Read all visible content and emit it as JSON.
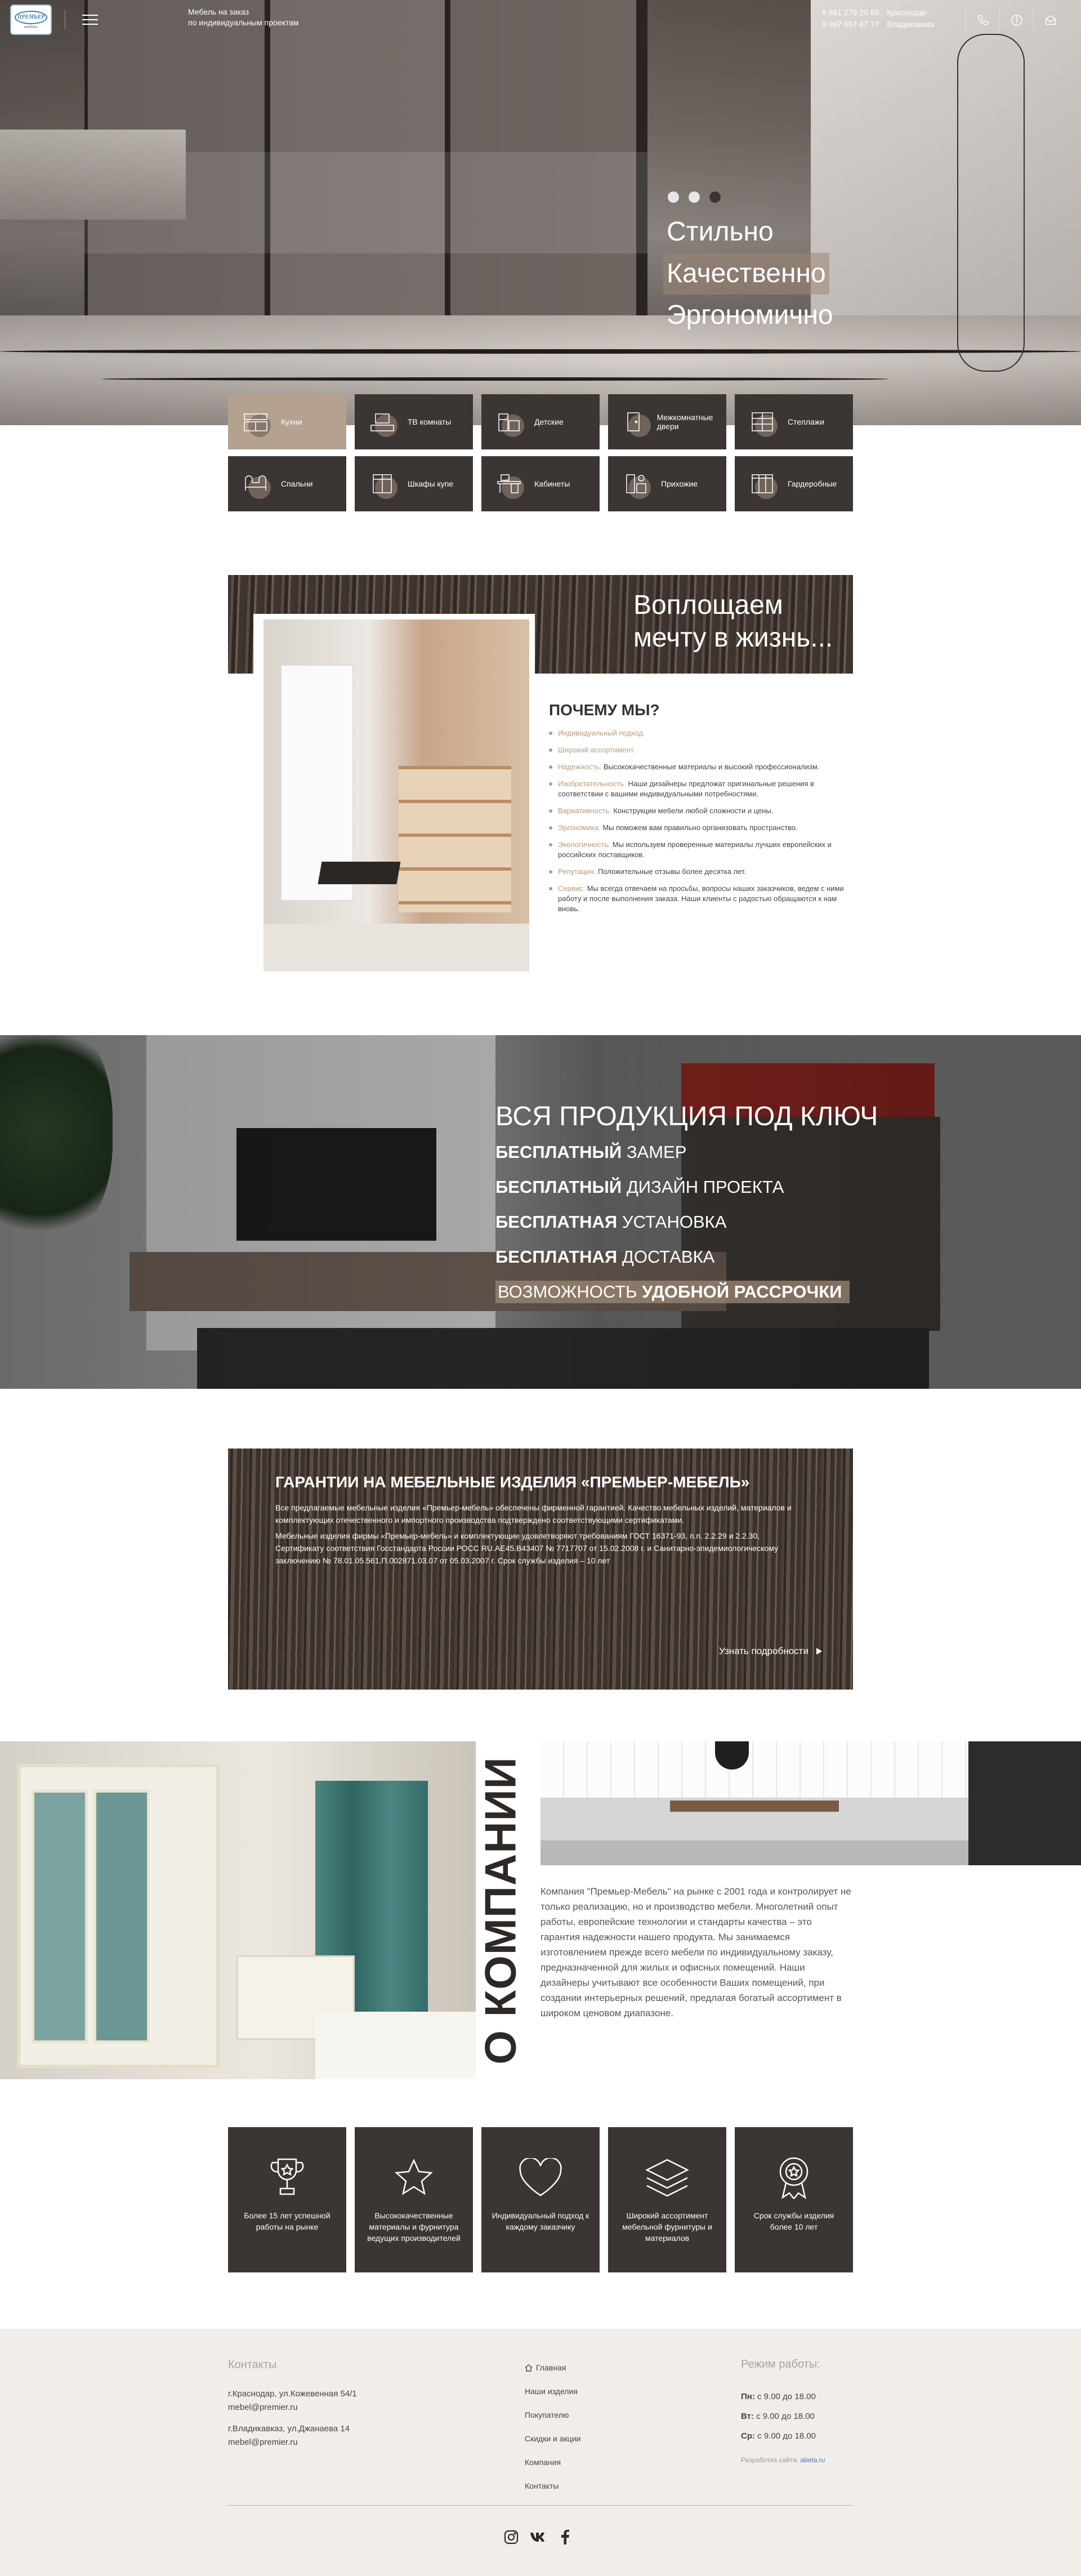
{
  "header": {
    "logo_text": "ПРЕМЬЕР",
    "logo_sub": "мебель",
    "tagline_line1": "Мебель на заказ",
    "tagline_line2": "по индивидуальным проектам",
    "phones": [
      {
        "number": "8 861 279 20 65",
        "city": "Краснодар"
      },
      {
        "number": "8 967 657 87 77",
        "city": "Владикавказ"
      }
    ]
  },
  "hero": {
    "slides_count": 3,
    "active_slide": 3,
    "slogans": [
      "Стильно",
      "Качественно",
      "Эргономично"
    ]
  },
  "categories": [
    {
      "label": "Кухни",
      "icon": "kitchen-icon",
      "active": true
    },
    {
      "label": "ТВ комнаты",
      "icon": "tv-room-icon"
    },
    {
      "label": "Детские",
      "icon": "kids-room-icon"
    },
    {
      "label": "Межкомнатные двери",
      "icon": "door-icon"
    },
    {
      "label": "Стеллажи",
      "icon": "shelving-icon"
    },
    {
      "label": "Спальни",
      "icon": "bedroom-icon"
    },
    {
      "label": "Шкафы купе",
      "icon": "wardrobe-icon"
    },
    {
      "label": "Кабинеты",
      "icon": "office-icon"
    },
    {
      "label": "Прихожие",
      "icon": "hallway-icon"
    },
    {
      "label": "Гардеробные",
      "icon": "dressing-room-icon"
    }
  ],
  "dream": {
    "title_line1": "Воплощаем",
    "title_line2": "мечту в жизнь..."
  },
  "why": {
    "title": "ПОЧЕМУ МЫ?",
    "items": [
      {
        "key": "Индивидуальный подход.",
        "text": ""
      },
      {
        "key": "Широкий ассортимент.",
        "text": ""
      },
      {
        "key": "Надежность.",
        "text": "Высококачественные материалы и высокий профессионализм."
      },
      {
        "key": "Изобретательность.",
        "text": "Наши дизайнеры предложат оригинальные решения в соответствии с вашими индивидуальными потребностями."
      },
      {
        "key": "Вариативность.",
        "text": "Конструкции мебели любой сложности и цены."
      },
      {
        "key": "Эргономика.",
        "text": "Мы поможем вам правильно организовать пространство."
      },
      {
        "key": "Экологичность.",
        "text": "Мы используем проверенные материалы лучших европейских и российских поставщиков."
      },
      {
        "key": "Репутация.",
        "text": "Положительные отзывы более десятка лет."
      },
      {
        "key": "Сервис.",
        "text": "Мы всегда отвечаем на просьбы, вопросы наших заказчиков, ведем с ними работу и после выполнения заказа. Наши клиенты с радостью обращаются к нам вновь."
      }
    ]
  },
  "turnkey": {
    "title": "ВСЯ ПРОДУКЦИЯ ПОД КЛЮЧ",
    "free_word": "БЕСПЛАТНЫЙ",
    "free_word2": "БЕСПЛАТНАЯ",
    "rows": [
      "ЗАМЕР",
      "ДИЗАЙН ПРОЕКТА",
      "УСТАНОВКА",
      "ДОСТАВКА"
    ],
    "last_prefix": "ВОЗМОЖНОСТЬ",
    "last_bold": "УДОБНОЙ РАССРОЧКИ"
  },
  "guarantee": {
    "title": "ГАРАНТИИ НА МЕБЕЛЬНЫЕ ИЗДЕЛИЯ «ПРЕМЬЕР-МЕБЕЛЬ»",
    "p1": "Все предлагаемые мебельные изделия «Премьер-мебель» обеспечены фирменной гарантией. Качество мебельных изделий, материалов и комплектующих отечественного и импортного производства подтверждено соответствующими сертификатами.",
    "p2": "Мебельные изделия фирмы «Премьер-мебель» и комплектующие удовлетворяют требованиям ГОСТ 16371-93, п.п. 2.2.29 и 2.2.30, Сертификату соответствия Госстандарта России РОСС RU.AE45.B43407 № 7717707 от 15.02.2008 г. и Санитарно-эпидемиологическому заключению № 78.01.05.561.П.002871.03.07 от 05.03.2007 г. Срок службы изделия – 10 лет",
    "more": "Узнать подробности"
  },
  "about": {
    "title": "О КОМПАНИИ",
    "text": "Компания \"Премьер-Мебель\" на рынке с 2001 года и контролирует не только реализацию, но и производство мебели. Многолетний опыт работы, европейские технологии и стандарты качества – это гарантия надежности нашего продукта. Мы занимаемся изготовлением прежде всего мебели по индивидуальному заказу, предназначенной для жилых и офисных помещений. Наши дизайнеры учитывают все особенности Ваших помещений, при создании интерьерных решений, предлагая богатый ассортимент в широком ценовом диапазоне."
  },
  "features": [
    {
      "icon": "trophy-icon",
      "label": "Более 15 лет успешной работы на рынке"
    },
    {
      "icon": "star-icon",
      "label": "Высококачественные материалы и фурнитура ведущих производителей"
    },
    {
      "icon": "heart-icon",
      "label": "Индивидуальный подход к каждому заказчику"
    },
    {
      "icon": "layers-icon",
      "label": "Широкий ассортимент мебельной фурнитуры и материалов"
    },
    {
      "icon": "badge-icon",
      "label": "Срок службы изделия более 10 лет"
    }
  ],
  "footer": {
    "contacts_title": "Контакты",
    "addr1": "г.Краснодар, ул.Кожевенная 54/1",
    "email1": "mebel@premier.ru",
    "addr2": "г.Владикавказ, ул.Джанаева 14",
    "email2": "mebel@premier.ru",
    "nav": [
      "Главная",
      "Наши изделия",
      "Покупателю",
      "Скидки и акции",
      "Компания",
      "Контакты"
    ],
    "hours_title": "Режим работы:",
    "hours": [
      {
        "day": "Пн:",
        "time": "с 9.00 до 18.00"
      },
      {
        "day": "Вт:",
        "time": "с 9.00 до 18.00"
      },
      {
        "day": "Ср:",
        "time": "с 9.00 до 18.00"
      }
    ],
    "dev_label": "Разработка сайта:",
    "dev_name": "abeta.ru",
    "social": [
      "instagram-icon",
      "vk-icon",
      "facebook-icon"
    ]
  },
  "colors": {
    "dark": "#3b3634",
    "accent": "#b4a190",
    "why_accent": "#b89a7d",
    "footer_bg": "#f1eeea"
  }
}
